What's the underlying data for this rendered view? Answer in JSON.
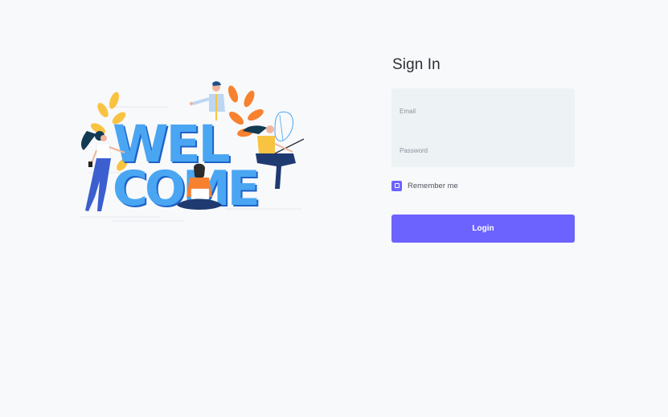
{
  "illustration": {
    "word_line1": "WEL",
    "word_line2": "COME"
  },
  "signin": {
    "title": "Sign In",
    "email_placeholder": "Email",
    "password_placeholder": "Password",
    "remember_label": "Remember me",
    "remember_checked": false,
    "login_label": "Login"
  },
  "colors": {
    "accent": "#6c63ff",
    "field_bg": "#edf2f4",
    "page_bg": "#f8f9fb",
    "welcome_blue": "#4aa6f2",
    "leaf_orange": "#f7812f",
    "leaf_yellow": "#f9c342"
  }
}
